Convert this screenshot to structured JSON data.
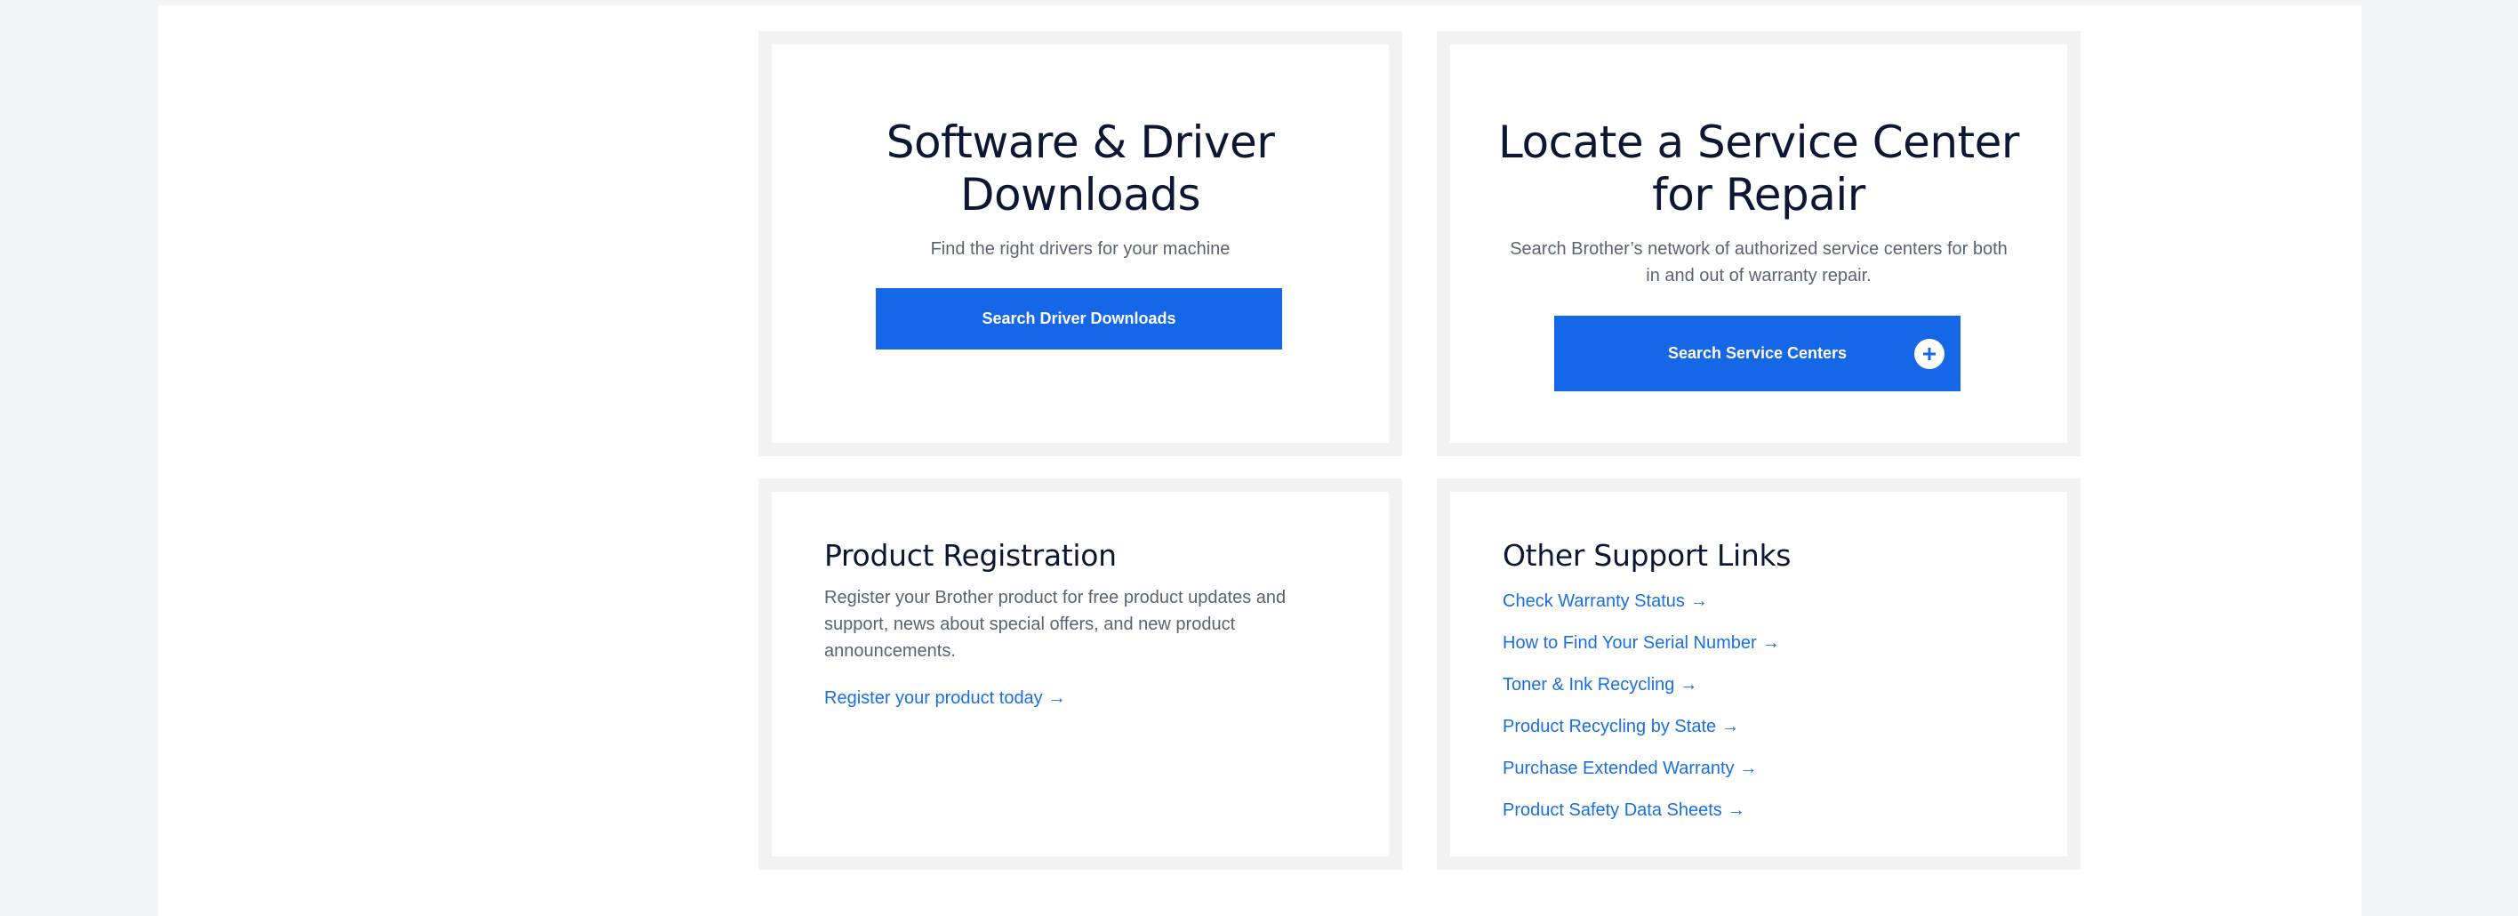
{
  "software_card": {
    "title_line1": "Software & Driver",
    "title_line2": "Downloads",
    "subtext": "Find the right drivers for your machine",
    "button_label": "Search Driver Downloads"
  },
  "service_card": {
    "title_line1": "Locate a Service Center",
    "title_line2": "for Repair",
    "subtext": "Search Brother’s network of authorized service centers for both in and out of warranty repair.",
    "button_label": "Search Service Centers",
    "button_icon": "plus-circle-icon"
  },
  "registration_card": {
    "title": "Product Registration",
    "body": "Register your Brother product for free product updates and support, news about special offers, and new product announcements.",
    "link_label": "Register your product today"
  },
  "support_links_card": {
    "title": "Other Support Links",
    "links": [
      {
        "label": "Check Warranty Status"
      },
      {
        "label": "How to Find Your Serial Number"
      },
      {
        "label": "Toner & Ink Recycling"
      },
      {
        "label": "Product Recycling by State"
      },
      {
        "label": "Purchase Extended Warranty"
      },
      {
        "label": "Product Safety Data Sheets"
      }
    ]
  },
  "arrow_glyph": "→",
  "colors": {
    "accent": "#1667e8",
    "link": "#1a6fe0",
    "heading": "#0d1733",
    "body_text": "#5b6370",
    "card_border": "#f2f2f2",
    "page_background": "#f3f4f6"
  }
}
